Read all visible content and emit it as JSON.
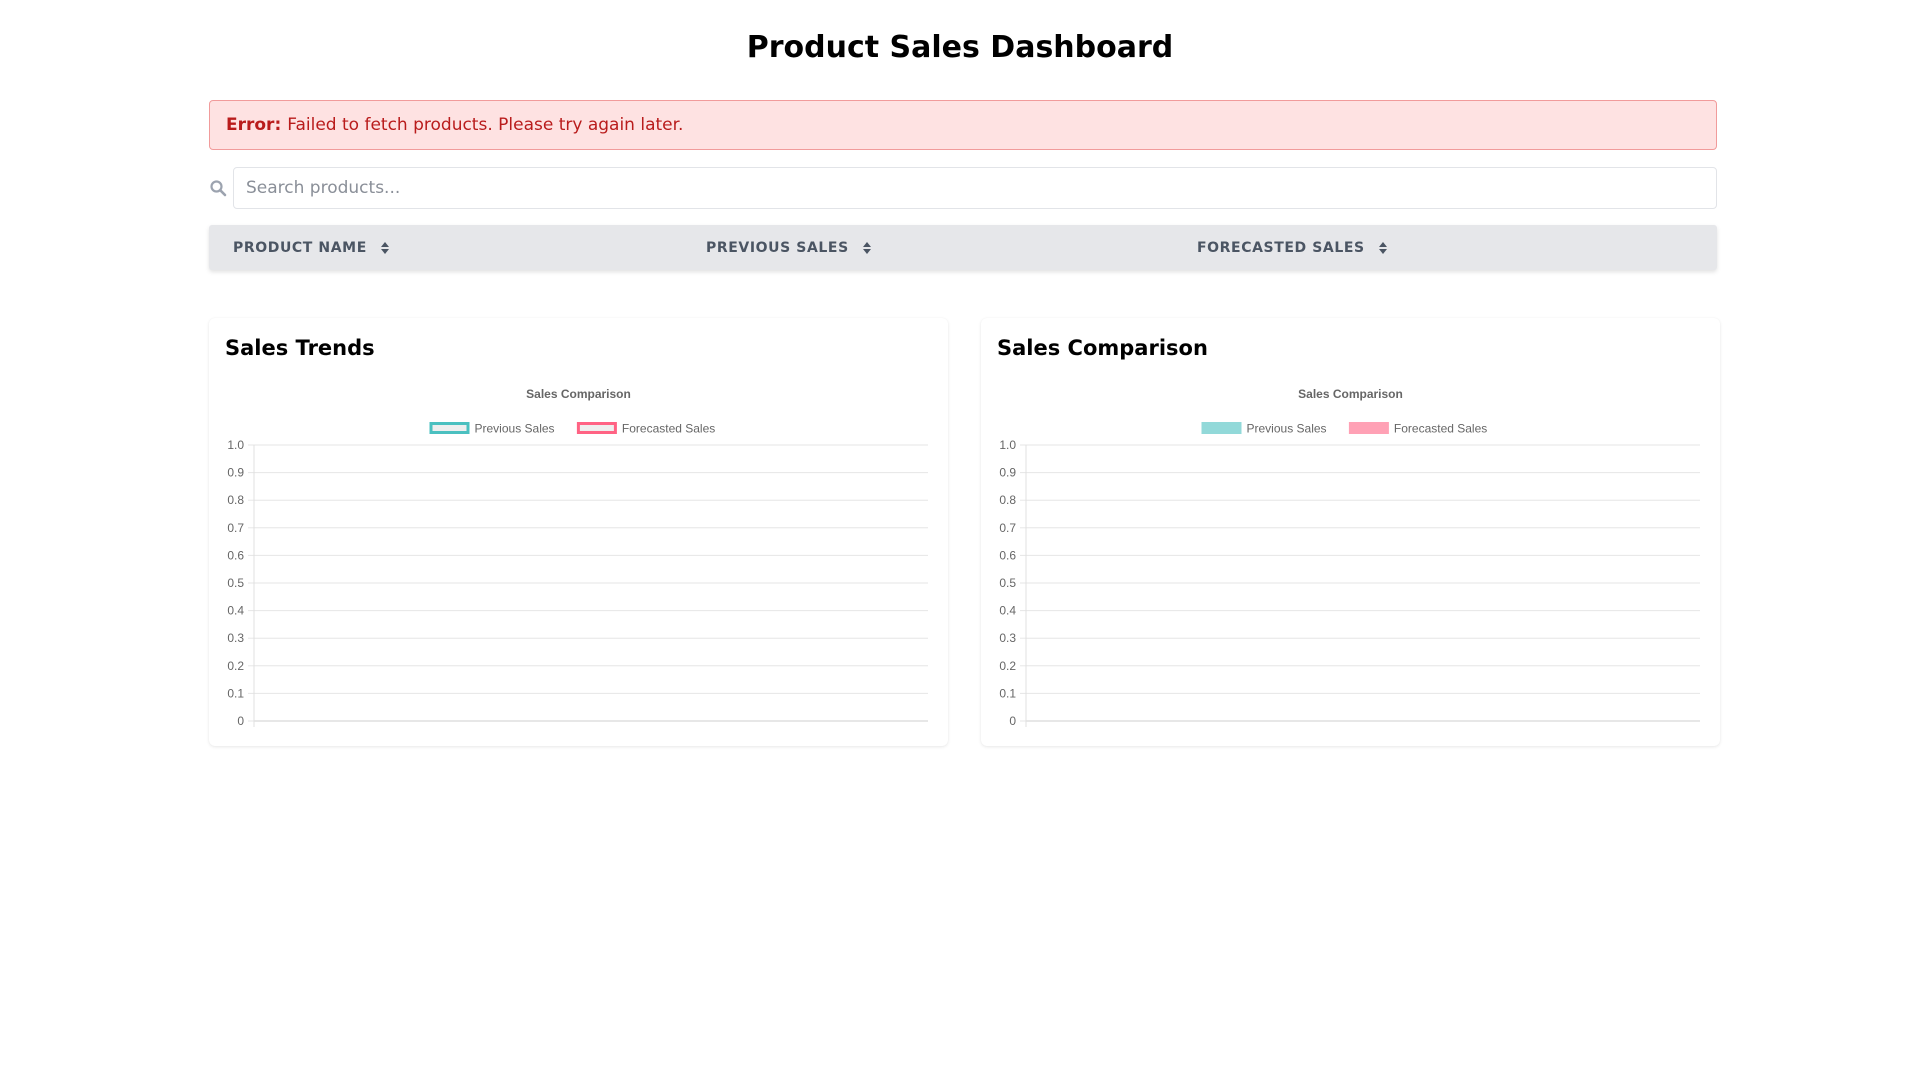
{
  "page": {
    "title": "Product Sales Dashboard"
  },
  "error": {
    "label": "Error:",
    "message": "Failed to fetch products. Please try again later."
  },
  "search": {
    "placeholder": "Search products...",
    "value": ""
  },
  "table": {
    "columns": [
      {
        "label": "PRODUCT NAME"
      },
      {
        "label": "PREVIOUS SALES"
      },
      {
        "label": "FORECASTED SALES"
      }
    ],
    "rows": []
  },
  "colors": {
    "previous": "#4bc0c0",
    "forecasted": "#ff6384",
    "previous_fill": "#92d9d9",
    "forecasted_fill": "#ffa1b5"
  },
  "charts": [
    {
      "card_title": "Sales Trends"
    },
    {
      "card_title": "Sales Comparison"
    }
  ],
  "chart_data": [
    {
      "type": "line",
      "title": "Sales Comparison",
      "series": [
        {
          "name": "Previous Sales",
          "values": []
        },
        {
          "name": "Forecasted Sales",
          "values": []
        }
      ],
      "categories": [],
      "ylim": [
        0,
        1.0
      ],
      "yticks": [
        "0",
        "0.1",
        "0.2",
        "0.3",
        "0.4",
        "0.5",
        "0.6",
        "0.7",
        "0.8",
        "0.9",
        "1.0"
      ],
      "grid": true,
      "legend": "top"
    },
    {
      "type": "bar",
      "title": "Sales Comparison",
      "series": [
        {
          "name": "Previous Sales",
          "values": []
        },
        {
          "name": "Forecasted Sales",
          "values": []
        }
      ],
      "categories": [],
      "ylim": [
        0,
        1.0
      ],
      "yticks": [
        "0",
        "0.1",
        "0.2",
        "0.3",
        "0.4",
        "0.5",
        "0.6",
        "0.7",
        "0.8",
        "0.9",
        "1.0"
      ],
      "grid": true,
      "legend": "top"
    }
  ]
}
